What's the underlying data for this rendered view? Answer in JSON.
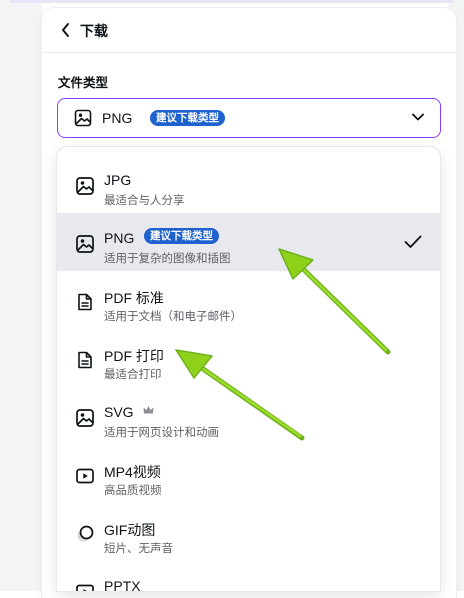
{
  "header": {
    "title": "下载"
  },
  "file_type": {
    "label": "文件类型",
    "selected": "PNG",
    "selected_badge": "建议下载类型"
  },
  "options": [
    {
      "title": "JPG",
      "desc": "最适合与人分享",
      "icon": "image-icon"
    },
    {
      "title": "PNG",
      "badge": "建议下载类型",
      "desc": "适用于复杂的图像和插图",
      "icon": "image-icon",
      "selected": true
    },
    {
      "title": "PDF 标准",
      "desc": "适用于文档（和电子邮件）",
      "icon": "document-icon"
    },
    {
      "title": "PDF 打印",
      "desc": "最适合打印",
      "icon": "document-icon"
    },
    {
      "title": "SVG",
      "desc": "适用于网页设计和动画",
      "icon": "image-icon",
      "premium": true
    },
    {
      "title": "MP4视频",
      "desc": "高品质视频",
      "icon": "video-icon"
    },
    {
      "title": "GIF动图",
      "desc": "短片、无声音",
      "icon": "gif-icon"
    },
    {
      "title": "PPTX",
      "icon": "presentation-icon"
    }
  ],
  "colors": {
    "accent": "#8b3dff",
    "badge": "#1f61cf",
    "annotation_arrow": "#8fd11a"
  }
}
